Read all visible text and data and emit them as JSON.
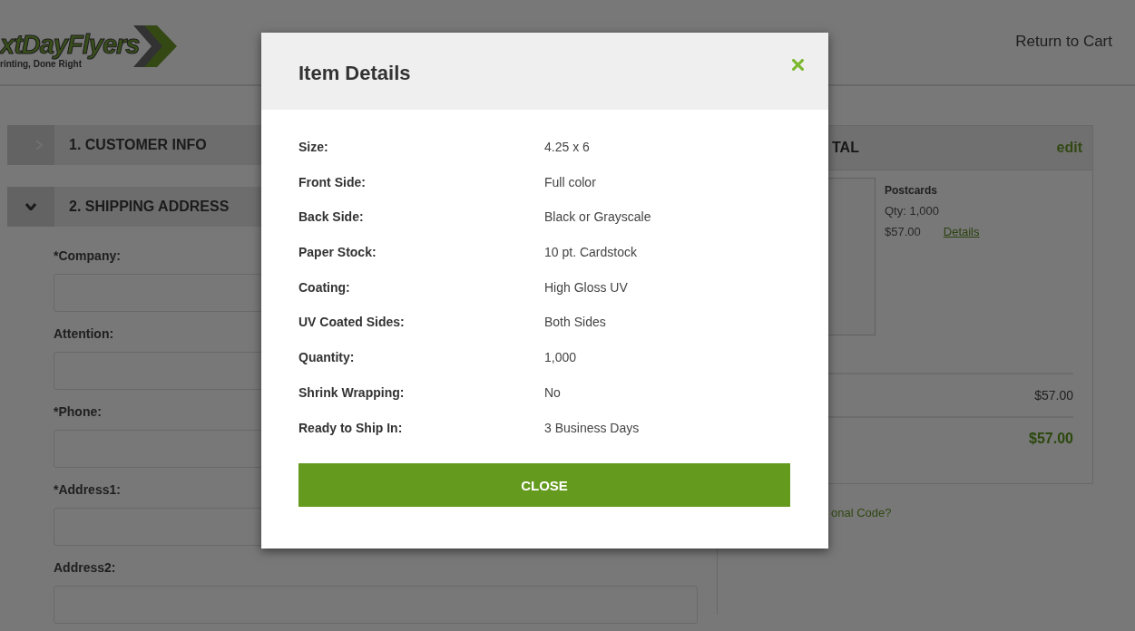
{
  "header": {
    "logo_name": "xtDayFlyers",
    "logo_tagline": "rinting, Done Right",
    "return_link": "Return to Cart"
  },
  "sections": [
    {
      "title": "1. CUSTOMER INFO",
      "expanded": false
    },
    {
      "title": "2. SHIPPING ADDRESS",
      "expanded": true,
      "fields": [
        {
          "label": "*Company:"
        },
        {
          "label": "Attention:"
        },
        {
          "label": "*Phone:"
        },
        {
          "label": "*Address1:"
        },
        {
          "label": "Address2:"
        }
      ]
    }
  ],
  "summary": {
    "title": "TAL",
    "edit_link": "edit",
    "item": {
      "name": "Postcards",
      "qty": "Qty: 1,000",
      "price": "$57.00",
      "details_link": "Details"
    },
    "subtotal": "$57.00",
    "total": "$57.00",
    "promo_link": "onal Code?"
  },
  "modal": {
    "title": "Item Details",
    "rows": [
      {
        "label": "Size:",
        "value": "4.25 x 6"
      },
      {
        "label": "Front Side:",
        "value": "Full color"
      },
      {
        "label": "Back Side:",
        "value": "Black or Grayscale"
      },
      {
        "label": "Paper Stock:",
        "value": "10 pt. Cardstock"
      },
      {
        "label": "Coating:",
        "value": "High Gloss UV"
      },
      {
        "label": "UV Coated Sides:",
        "value": "Both Sides"
      },
      {
        "label": "Quantity:",
        "value": "1,000"
      },
      {
        "label": "Shrink Wrapping:",
        "value": "No"
      },
      {
        "label": "Ready to Ship In:",
        "value": "3 Business Days"
      }
    ],
    "button": "CLOSE"
  }
}
